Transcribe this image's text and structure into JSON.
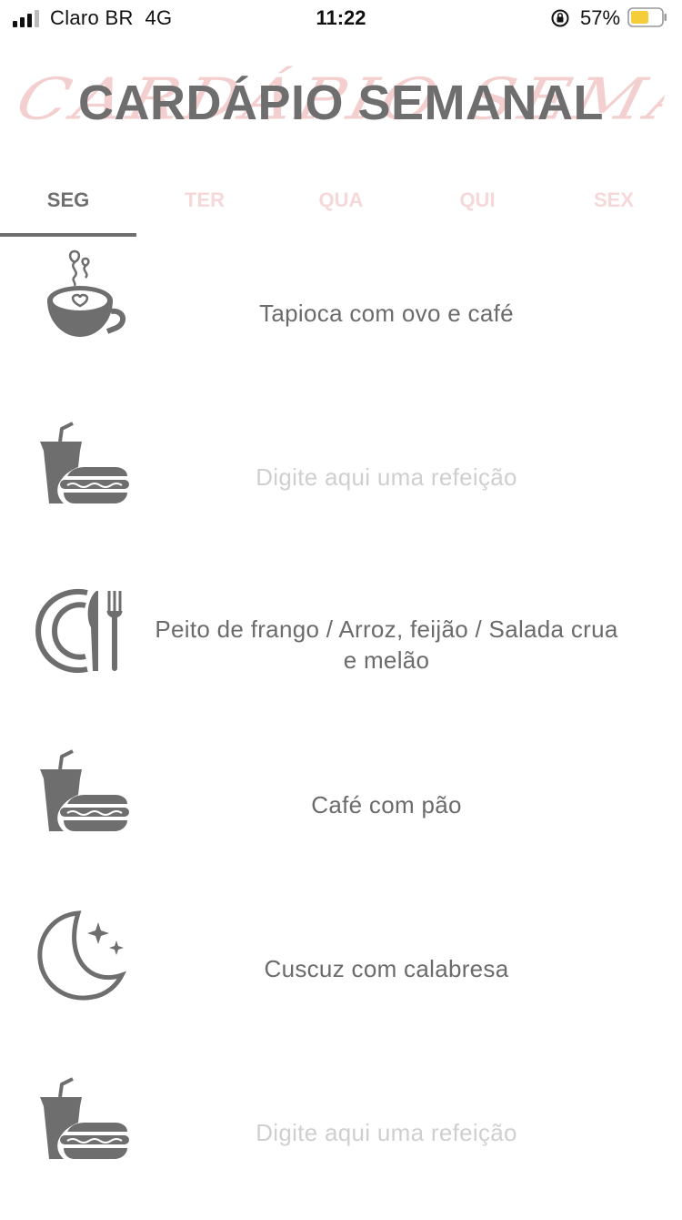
{
  "status_bar": {
    "carrier": "Claro BR",
    "network": "4G",
    "time": "11:22",
    "battery": "57%"
  },
  "header": {
    "script_title": "CARDÁPIO SEMANAL",
    "title": "CARDÁPIO SEMANAL"
  },
  "tabs": [
    {
      "label": "SEG",
      "active": true
    },
    {
      "label": "TER",
      "active": false
    },
    {
      "label": "QUA",
      "active": false
    },
    {
      "label": "QUI",
      "active": false
    },
    {
      "label": "SEX",
      "active": false
    }
  ],
  "meals": [
    {
      "icon": "coffee-cup-icon",
      "text": "Tapioca com ovo e café"
    },
    {
      "icon": "snack-drink-hotdog-icon",
      "text": "Digite aqui uma refeição",
      "placeholder": true
    },
    {
      "icon": "plate-cutlery-icon",
      "text": "Peito de frango / Arroz, feijão / Salada crua e melão"
    },
    {
      "icon": "snack-drink-hotdog-icon",
      "text": "Café com pão"
    },
    {
      "icon": "moon-stars-icon",
      "text": "Cuscuz com calabresa"
    },
    {
      "icon": "snack-drink-hotdog-icon",
      "text": "Digite aqui uma refeição",
      "placeholder": true
    }
  ],
  "colors": {
    "accent_gray": "#6e6e6e",
    "inactive_tab_pink": "#f6d8d8",
    "script_pink": "#f4cfcf",
    "placeholder_gray": "#cfcfcf",
    "battery_yellow": "#f5cc3a"
  }
}
